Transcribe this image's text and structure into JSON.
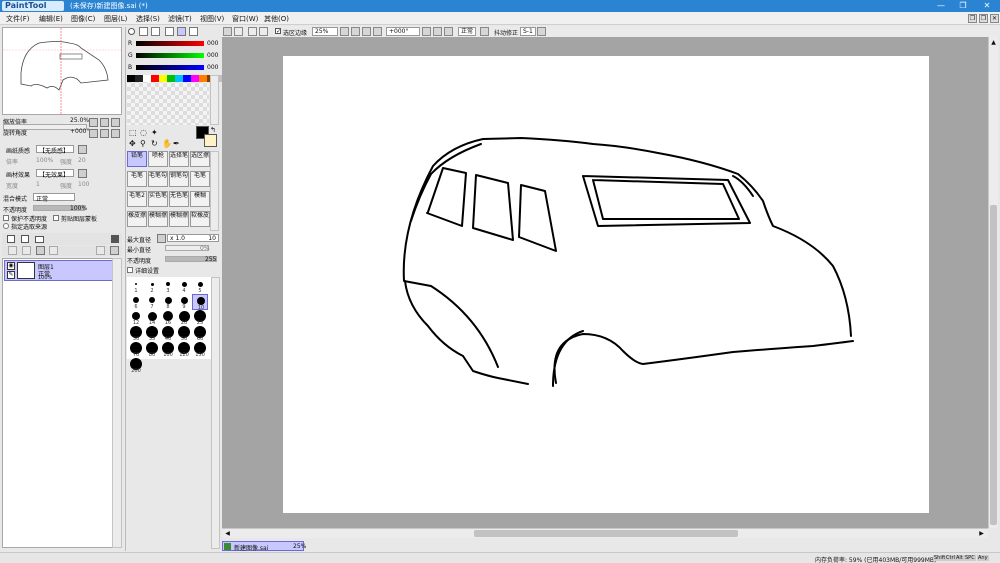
{
  "window": {
    "logo": "PaintTool SAI",
    "title": "(未保存)新建图像.sai (*)"
  },
  "menu": [
    "文件(F)",
    "编辑(E)",
    "图像(C)",
    "图层(L)",
    "选择(S)",
    "滤镜(T)",
    "视图(V)",
    "窗口(W)",
    "其他(O)"
  ],
  "navigator": {
    "zoom_label": "缩放倍率",
    "zoom_value": "25.0%",
    "rotate_label": "旋转角度",
    "rotate_value": "+000°"
  },
  "layer_props": {
    "paper_texture_label": "画纸质感",
    "paper_texture_value": "【无质感】",
    "scale_label": "倍率",
    "scale_value": "100%",
    "strength_label": "强度",
    "strength_value": "20",
    "paper_effect_label": "画材效果",
    "paper_effect_value": "【无效果】",
    "width_label": "宽度",
    "width_value": "1",
    "strength2_label": "强度",
    "strength2_value": "100",
    "blend_label": "混合模式",
    "blend_value": "正常",
    "opacity_label": "不透明度",
    "opacity_value": "100%",
    "protect_opacity": "保护不透明度",
    "clip_group": "剪贴图层蒙板",
    "selection_source": "指定选取来源"
  },
  "layers": [
    {
      "name": "图层1",
      "mode": "正常",
      "opacity": "100%"
    }
  ],
  "color": {
    "r_label": "R",
    "r_value": "000",
    "g_label": "G",
    "g_value": "000",
    "b_label": "B",
    "b_value": "000",
    "primary": "#000000",
    "secondary": "#fff2c8",
    "palette": [
      "#000000",
      "#202020",
      "#ffffff",
      "#ff0000",
      "#ffff00",
      "#00c000",
      "#00c0ff",
      "#0000ff",
      "#ff00ff",
      "#ff8000",
      "#804000",
      "#c0c0c0",
      "#ff80c0",
      "#80ff80",
      "#8080ff",
      "#ffffc0"
    ]
  },
  "tools": [
    [
      "铅笔",
      "喷枪",
      "选择笔",
      "选区擦"
    ],
    [
      "毛笔",
      "毛笔勾",
      "钢笔勾",
      "毛笔"
    ],
    [
      "毛笔2",
      "实色笔",
      "无色笔",
      "模糊"
    ],
    [
      "橡皮擦",
      "模糊擦",
      "模糊擦",
      "软橡皮"
    ]
  ],
  "brush": {
    "max_size_label": "最大直径",
    "max_size_mult": "x 1.0",
    "max_size_value": "10",
    "min_size_label": "最小直径",
    "min_size_value": "0%",
    "opacity_label": "不透明度",
    "opacity_value": "255",
    "detail_label": "详细设置",
    "sizes": [
      "1",
      "2",
      "3",
      "4",
      "5",
      "6",
      "7",
      "8",
      "9",
      "10",
      "12",
      "14",
      "16",
      "20",
      "25",
      "30",
      "35",
      "40",
      "50",
      "60",
      "70",
      "80",
      "100",
      "120",
      "150",
      "200"
    ],
    "selected_size": "10"
  },
  "canvas_toolbar": {
    "selection_edge": "选区边缘",
    "zoom": "25%",
    "rotate": "+000°",
    "blend": "正常",
    "stabilizer_label": "抖动修正",
    "stabilizer_value": "S-1"
  },
  "document_tab": {
    "name": "新建图像.sai",
    "zoom": "25%"
  },
  "status": {
    "memory": "内存负荷率: 59% (已用403MB/可用999MB)",
    "indicators": [
      "Shift",
      "Ctrl",
      "Alt",
      "SPC",
      "Any"
    ]
  }
}
